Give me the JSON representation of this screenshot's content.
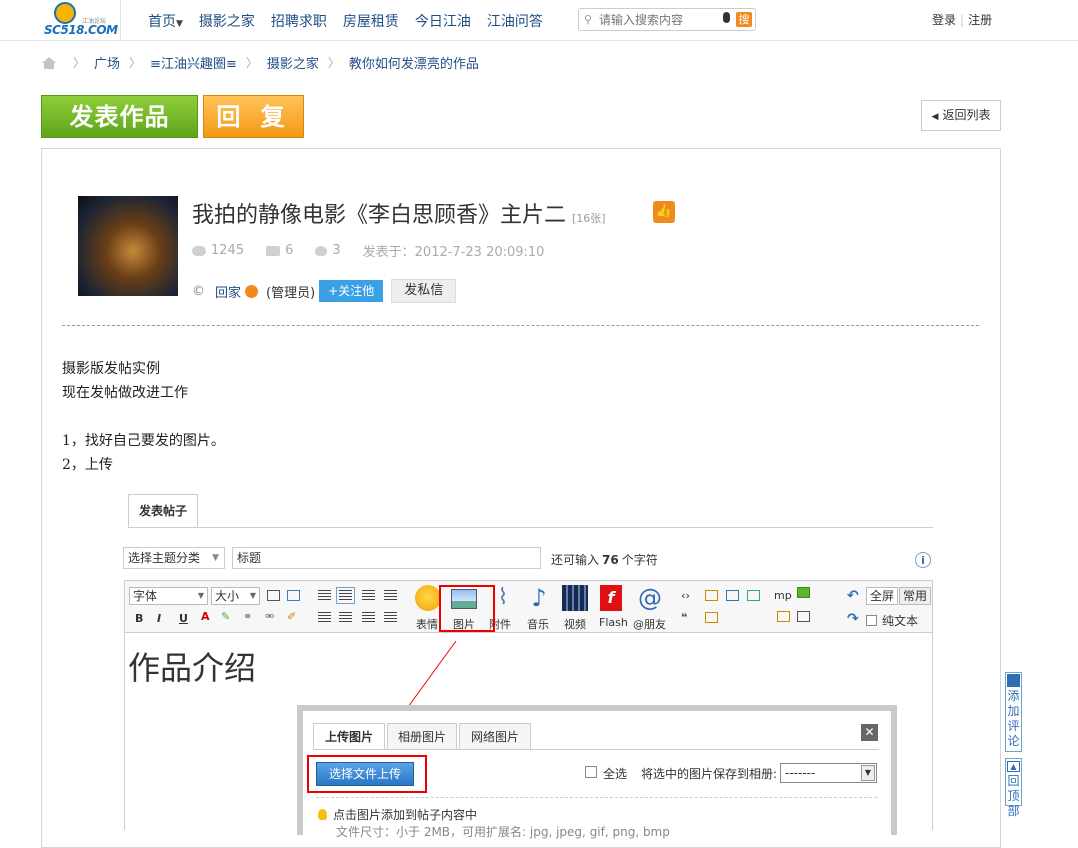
{
  "header": {
    "logo_text": "SC518.COM",
    "logo_sub": "江油论坛",
    "nav": [
      {
        "label": "首页",
        "has_caret": true
      },
      {
        "label": "摄影之家"
      },
      {
        "label": "招聘求职"
      },
      {
        "label": "房屋租赁"
      },
      {
        "label": "今日江油"
      },
      {
        "label": "江油问答"
      }
    ],
    "search_placeholder": "请输入搜索内容",
    "search_button": "搜",
    "login": "登录",
    "register": "注册"
  },
  "breadcrumb": [
    "广场",
    "≡江油兴趣圈≡",
    "摄影之家",
    "教你如何发漂亮的作品"
  ],
  "actions": {
    "post": "发表作品",
    "reply": "回 复",
    "back": "返回列表"
  },
  "post": {
    "title": "我拍的静像电影《李白思顾香》主片二",
    "image_count": "[16张]",
    "views": "1245",
    "comments": "6",
    "likes": "3",
    "posted_at": "发表于：2012-7-23 20:09:10",
    "copyright_mark": "©",
    "author": "回家",
    "role": "(管理员)",
    "follow": "+关注他",
    "message": "发私信",
    "body_lines": [
      "摄影版发帖实例",
      "现在发帖做改进工作",
      "",
      "1，找好自己要发的图片。",
      "2，上传"
    ]
  },
  "editor": {
    "tab": "发表帖子",
    "type_select": "选择主题分类",
    "title_placeholder": "标题",
    "remain_prefix": "还可输入",
    "remain_count": "76",
    "remain_suffix": "个字符",
    "font_select": "字体",
    "size_select": "大小",
    "tools": {
      "emoji": "表情",
      "image": "图片",
      "attach": "附件",
      "music": "音乐",
      "video": "视频",
      "flash": "Flash",
      "mention": "@朋友",
      "fullscreen": "全屏",
      "common": "常用",
      "plaintext": "纯文本",
      "mp": "mp",
      "bold": "B",
      "italic": "I",
      "underline": "U"
    },
    "heading": "作品介绍"
  },
  "dialog": {
    "tabs": [
      "上传图片",
      "相册图片",
      "网络图片"
    ],
    "upload_button": "选择文件上传",
    "select_all": "全选",
    "save_to": "将选中的图片保存到相册:",
    "album_value": "-------",
    "hint": "点击图片添加到帖子内容中",
    "hint2": "文件尺寸：小于 2MB，可用扩展名: jpg, jpeg, gif, png, bmp"
  },
  "side": {
    "comment": "添加评论",
    "top": "回顶部"
  }
}
